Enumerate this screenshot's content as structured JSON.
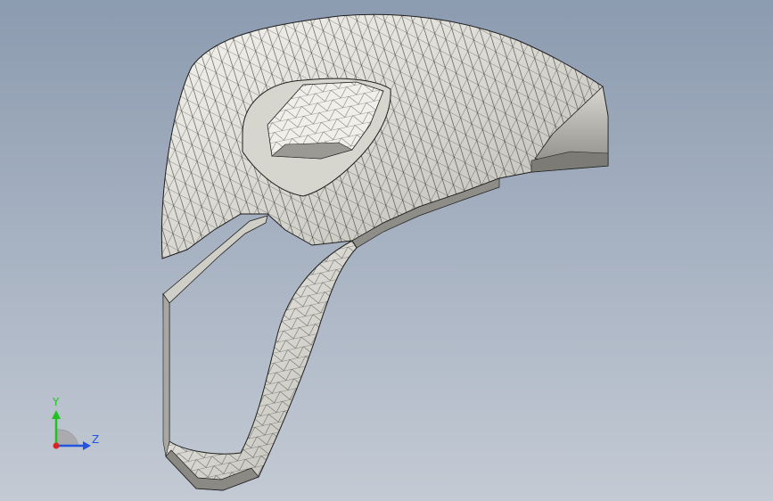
{
  "viewport": {
    "background_top": "#8c9bb0",
    "background_bottom": "#c3cad4",
    "model": {
      "name": "mesh-part",
      "face_color": "#ecebe4",
      "edge_color": "#1e1e1e",
      "shadow_color": "#6d6c66"
    }
  },
  "triad": {
    "x_label": "",
    "y_label": "Y",
    "z_label": "Z",
    "y_color": "#22c022",
    "z_color": "#2255dd",
    "x_color": "#dd2222"
  }
}
